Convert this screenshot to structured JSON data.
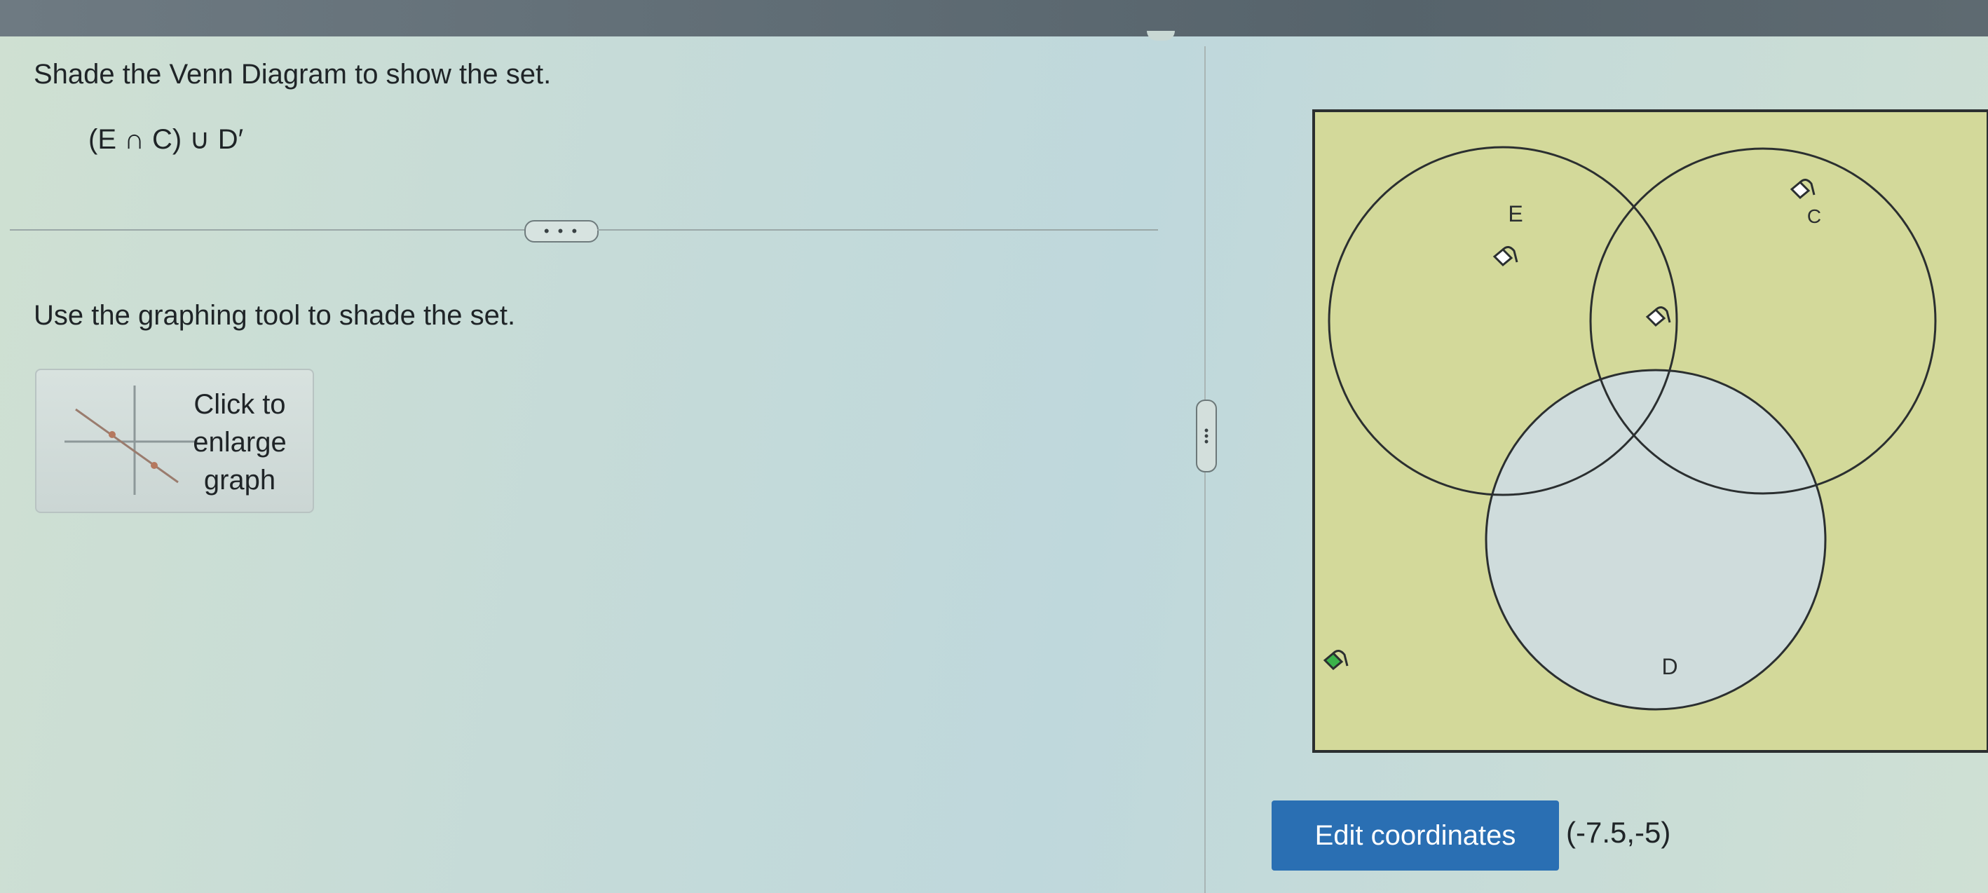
{
  "question": {
    "instruction": "Shade the Venn Diagram to show the set.",
    "expression": "(E ∩ C) ∪ D′"
  },
  "separator": {
    "expand_label": "• • •"
  },
  "tool": {
    "instruction": "Use the graphing tool to shade the set.",
    "enlarge_line1": "Click to",
    "enlarge_line2": "enlarge",
    "enlarge_line3": "graph"
  },
  "venn": {
    "sets": [
      {
        "label": "E"
      },
      {
        "label": "C"
      },
      {
        "label": "D"
      }
    ],
    "shaded_region_color": "#d3d99a",
    "unshaded_region_color": "#cfdcdc",
    "paint_bucket_active_color": "#3bb24a",
    "paint_bucket_icon": "paint-bucket-icon"
  },
  "footer": {
    "edit_coordinates_label": "Edit coordinates",
    "coordinates": "(-7.5,-5)"
  },
  "colors": {
    "primary_button": "#2a6fb3",
    "topbar": "#606d75"
  }
}
